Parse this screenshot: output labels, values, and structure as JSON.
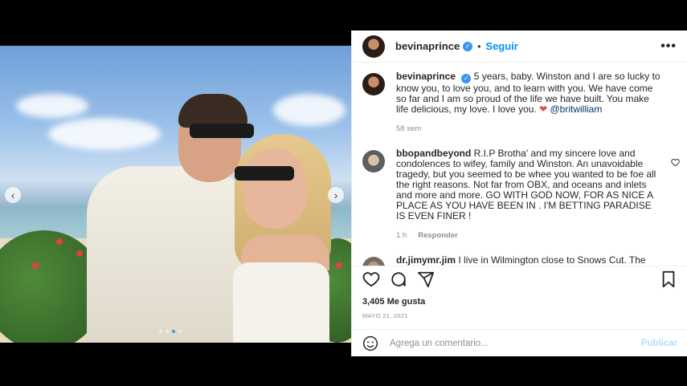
{
  "post": {
    "username": "bevinaprince",
    "follow_label": "Seguir",
    "separator": "•",
    "more_label": "•••"
  },
  "caption": {
    "username": "bevinaprince",
    "text": "5 years, baby. Winston and I are so lucky to know you, to love you, and to learn with you. We have come so far and I am so proud of the life we have built. You make life delicious, my love. I love you.",
    "heart": "❤",
    "mention": "@britwilliam",
    "time": "58 sem"
  },
  "comments": [
    {
      "username": "bbopandbeyond",
      "text": "R.I.P Brotha' and my sincere love and condolences to wifey, family and Winston. An unavoidable tragedy, but you seemed to be whee you wanted to be foe all the right reasons. Not far from OBX, and oceans and inlets and more and more. GO WITH GOD NOW, FOR AS NICE A PLACE AS YOU HAVE BEEN IN . I'M BETTING PARADISE IS EVEN FINER !",
      "time": "1 h",
      "reply_label": "Responder"
    },
    {
      "username": "dr.jimymr.jim",
      "text": "I live in Wilmington close to Snows Cut. The storm wasn't typical the clouds were north west but lighting",
      "time": "",
      "reply_label": ""
    }
  ],
  "likes": "3,405 Me gusta",
  "date": "MAYO 21, 2021",
  "add_comment": {
    "placeholder": "Agrega un comentario...",
    "publish_label": "Publicar"
  },
  "carousel": {
    "prev": "‹",
    "next": "›",
    "active_index": 2,
    "total": 4
  },
  "colors": {
    "accent": "#0095f6",
    "verified": "#3897f0",
    "heart": "#ed4956"
  }
}
